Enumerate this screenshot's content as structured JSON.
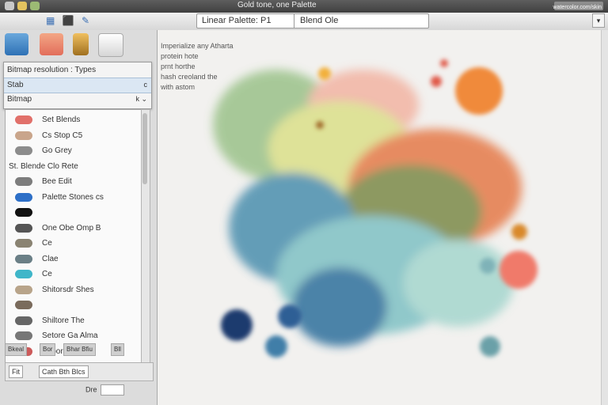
{
  "titlebar": {
    "title": "Gold tone, one Palette",
    "corner_text": "watercolor.com/skin"
  },
  "toolbar": {
    "document_name": "Linear Palette: P1",
    "mode_label": "Blend Ole",
    "menu_button": "▾"
  },
  "panel": {
    "dropdown": [
      {
        "label": "Bitmap resolution : Types",
        "caret": ""
      },
      {
        "label": "Stab",
        "caret": "c"
      },
      {
        "label": "Bitmap",
        "caret": "k ⌄"
      }
    ],
    "list_items": [
      {
        "label": "Set Blends",
        "color": "#e1706a"
      },
      {
        "label": "Cs Stop C5",
        "color": "#c9a58b"
      },
      {
        "label": "Go Grey",
        "color": "#8c8c8c"
      },
      {
        "label": "St. Blende  Clo  Rete",
        "color": ""
      },
      {
        "label": "Bee  Edit",
        "color": "#7d7d7d"
      },
      {
        "label": "Palette  Stones  cs",
        "color": "#2d6fc7"
      },
      {
        "label": "",
        "color": "#111111"
      },
      {
        "label": "One  Obe  Omp  B",
        "color": "#555555"
      },
      {
        "label": "Ce",
        "color": "#8a8372"
      },
      {
        "label": "Clae",
        "color": "#6a7f86"
      },
      {
        "label": "Ce",
        "color": "#3fb6c9"
      },
      {
        "label": "Shitorsdr  Shes",
        "color": "#b8a48a"
      },
      {
        "label": "",
        "color": "#7a6b5c"
      },
      {
        "label": "Shiltore  The",
        "color": "#666666"
      },
      {
        "label": "Setore  Ga  Alma",
        "color": "#777777"
      },
      {
        "label": "Beoorbe  Blaze",
        "color": "#cc5a5a"
      }
    ],
    "bottom_tabs": [
      "Bkeal",
      "Bor",
      "Bhar Bfiu",
      "Bll"
    ],
    "bottom_fields": [
      "Fit",
      "Cath Bth Blcs"
    ],
    "zoom_label": "Dre"
  },
  "canvas": {
    "caption_lines": [
      "Imperialize any Atharta",
      "protein hote",
      "prnt horthe",
      "hash creoland the",
      "with astom"
    ]
  },
  "colors": {
    "accent": "#3b6fb3",
    "panel_bg": "#dcdcdc",
    "canvas_bg": "#f2f1ef"
  }
}
